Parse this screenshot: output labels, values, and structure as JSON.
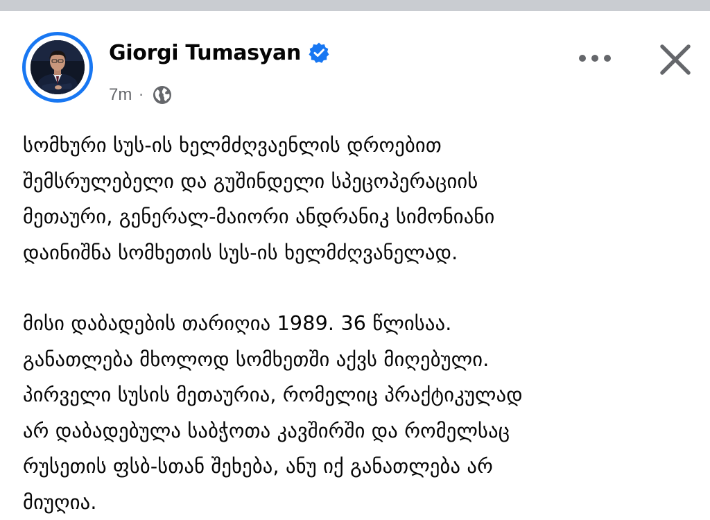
{
  "colors": {
    "accent": "#1877f2",
    "text_primary": "#050505",
    "text_secondary": "#65676b",
    "top_strip": "#c9ccd1"
  },
  "post": {
    "author": {
      "name": "Giorgi Tumasyan",
      "verified_icon": "verified-badge-icon",
      "avatar_icon": "profile-photo"
    },
    "meta": {
      "time": "7m",
      "separator": "·",
      "audience_icon": "globe-icon"
    },
    "actions": {
      "more_icon": "more-options-icon",
      "close_icon": "close-icon"
    },
    "body": {
      "paragraphs": [
        {
          "lines": [
            "სომხური სუს-ის ხელმძღვაენლის დროებით",
            "შემსრულებელი და გუშინდელი სპეცოპერაციის",
            "მეთაური, გენერალ-მაიორი ანდრანიკ სიმონიანი",
            "დაინიშნა სომხეთის სუს-ის ხელმძღვანელად."
          ]
        },
        {
          "lines": [
            "მისი დაბადების თარიღია 1989. 36 წლისაა.",
            "განათლება მხოლოდ სომხეთში აქვს მიღებული.",
            "პირველი სუსის მეთაურია, რომელიც პრაქტიკულად",
            "არ დაბადებულა საბჭოთა კავშირში და რომელსაც",
            "რუსეთის ფსბ-სთან შეხება, ანუ იქ განათლება არ",
            "მიუღია."
          ]
        }
      ]
    }
  }
}
